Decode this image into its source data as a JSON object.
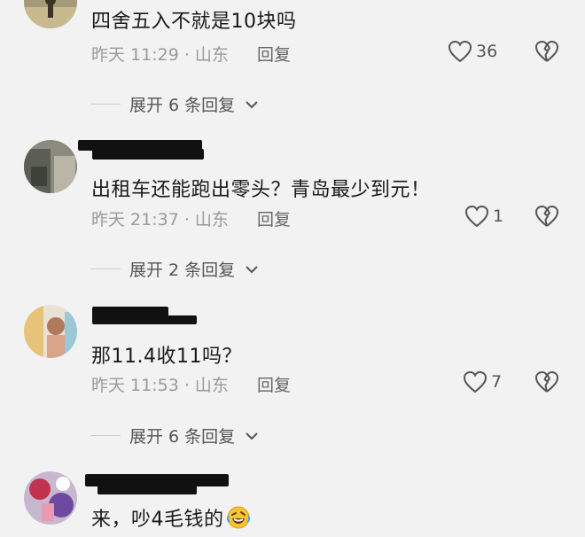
{
  "comments": [
    {
      "text": "四舍五入不就是10块吗",
      "time": "昨天 11:29",
      "location": "山东",
      "reply_label": "回复",
      "likes": "36",
      "expand_label": "展开 6 条回复"
    },
    {
      "text": "出租车还能跑出零头？青岛最少到元！",
      "time": "昨天 21:37",
      "location": "山东",
      "reply_label": "回复",
      "likes": "1",
      "expand_label": "展开 2 条回复"
    },
    {
      "text": "那11.4收11吗？",
      "time": "昨天 11:53",
      "location": "山东",
      "reply_label": "回复",
      "likes": "7",
      "expand_label": "展开 6 条回复"
    },
    {
      "text": "来，吵4毛钱的",
      "emoji": "rolling-on-floor-laughing-emoji"
    }
  ],
  "icons": {
    "like": "heart-outline-icon",
    "dislike": "broken-heart-icon",
    "expand": "chevron-down-icon"
  },
  "separator": " · "
}
